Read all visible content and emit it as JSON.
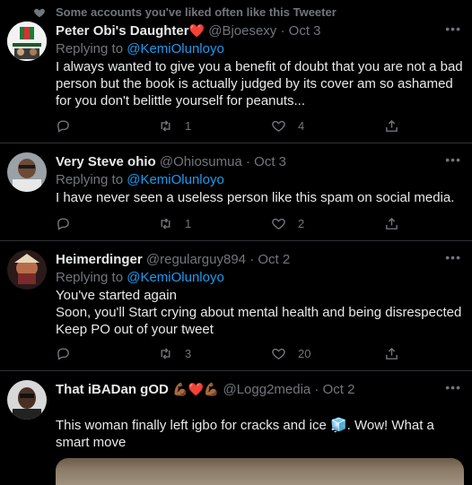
{
  "social_context": {
    "text": "Some accounts you've liked often like this Tweeter",
    "icon": "heart-icon"
  },
  "tweets": [
    {
      "name": "Peter Obi's Daughter",
      "name_emoji": "❤️",
      "handle": "@Bjoesexy",
      "dot": "·",
      "date": "Oct 3",
      "replying_prefix": "Replying to",
      "replying_to": "@KemiOlunloyo",
      "text": "I always wanted to give you a benefit of doubt that you are not a bad person but the book is actually judged by its cover am so ashamed for you don't belittle yourself for peanuts...",
      "retweets": "1",
      "likes": "4"
    },
    {
      "name": "Very Steve ohio",
      "handle": "@Ohiosumua",
      "dot": "·",
      "date": "Oct 3",
      "replying_prefix": "Replying to",
      "replying_to": "@KemiOlunloyo",
      "text": "I have never seen a useless person like this spam on social media.",
      "retweets": "1",
      "likes": "2"
    },
    {
      "name": "Heimerdinger",
      "handle": "@regularguy894",
      "dot": "·",
      "date": "Oct 2",
      "replying_prefix": "Replying to",
      "replying_to": "@KemiOlunloyo",
      "text_lines": [
        "You've started again",
        "Soon, you'll Start crying about mental health and being disrespected",
        "Keep PO out of your tweet"
      ],
      "retweets": "3",
      "likes": "20"
    },
    {
      "name": "That iBADan gOD",
      "name_emoji": "💪🏾❤️💪🏾",
      "handle": "@Logg2media",
      "dot": "·",
      "date": "Oct 2",
      "text": "This woman finally left igbo for cracks and ice 🧊. Wow! What a smart move"
    }
  ],
  "colors": {
    "background": "#000000",
    "text": "#e7e9ea",
    "muted": "#71767b",
    "link": "#1d9bf0",
    "divider": "#2f3336"
  }
}
